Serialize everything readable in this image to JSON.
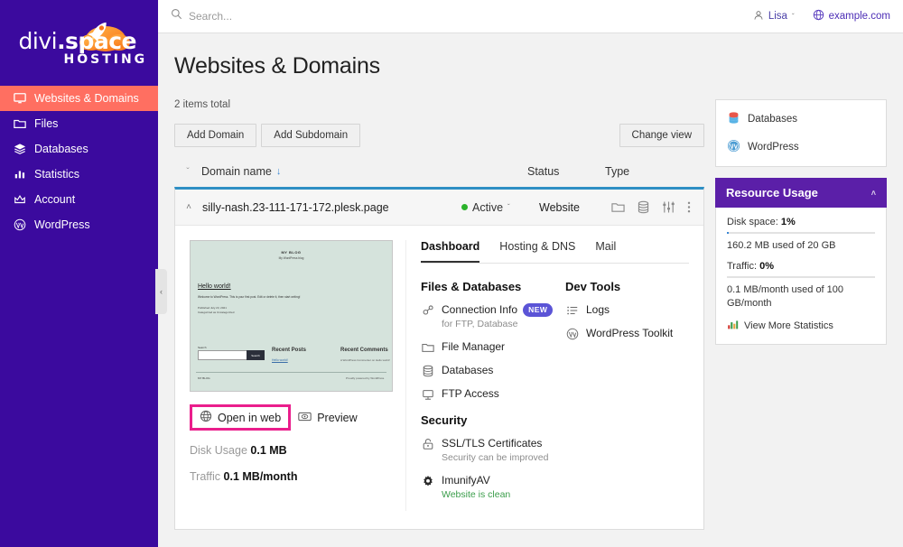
{
  "brand": {
    "logo_text_1": "divi",
    "logo_text_2": ".space",
    "logo_sub": "HOSTING",
    "sidebar_bg": "#3b0a9e",
    "active_bg": "#ff6f61",
    "accent_purple": "#5b1fa8",
    "highlight_pink": "#ea1e8c"
  },
  "sidebar": {
    "items": [
      {
        "label": "Websites & Domains",
        "icon": "monitor-icon",
        "active": true
      },
      {
        "label": "Files",
        "icon": "folder-icon",
        "active": false
      },
      {
        "label": "Databases",
        "icon": "layers-icon",
        "active": false
      },
      {
        "label": "Statistics",
        "icon": "bar-chart-icon",
        "active": false
      },
      {
        "label": "Account",
        "icon": "crown-icon",
        "active": false
      },
      {
        "label": "WordPress",
        "icon": "wordpress-icon",
        "active": false
      }
    ],
    "collapse_glyph": "‹"
  },
  "topbar": {
    "search_placeholder": "Search...",
    "search_value": "",
    "user_label": "Lisa",
    "domain_label": "example.com",
    "caret": "ˇ"
  },
  "header": {
    "title": "Websites & Domains"
  },
  "toolbar": {
    "items_total": "2 items total",
    "add_domain": "Add Domain",
    "add_subdomain": "Add Subdomain",
    "change_view": "Change view"
  },
  "table": {
    "columns": {
      "domain": "Domain name",
      "status": "Status",
      "type": "Type"
    },
    "sort_arrow": "↓",
    "expand_all_glyph": "ˇ",
    "row": {
      "collapse_glyph": "˄",
      "domain": "silly-nash.23-111-171-172.plesk.page",
      "status": "Active",
      "status_color": "#2bb32b",
      "type": "Website",
      "actions": [
        "folder-icon",
        "database-icon",
        "sliders-icon",
        "kebab-menu-icon"
      ]
    }
  },
  "thumbnail": {
    "site_title": "MY BLOG",
    "site_tagline": "My WordPress blog",
    "post_title": "Hello world!",
    "post_excerpt": "Welcome to WordPress. This is your first post. Edit or delete it, then start writing!",
    "post_meta_1": "Published July 23, 2021",
    "post_meta_2": "Categorized as Uncategorized",
    "search_label": "Search",
    "search_button": "Search",
    "recent_posts_title": "Recent Posts",
    "recent_posts_link": "Hello world!",
    "recent_comments_title": "Recent Comments",
    "recent_comments_text": "A WordPress Commenter on Hello world!",
    "footer_left": "MY BLOG",
    "footer_right": "Proudly powered by WordPress."
  },
  "thumb_actions": {
    "open_in_web": "Open in web",
    "open_in_web_icon": "globe-icon",
    "preview": "Preview",
    "preview_icon": "preview-icon"
  },
  "stats": {
    "disk_label": "Disk Usage",
    "disk_value": "0.1 MB",
    "traffic_label": "Traffic",
    "traffic_value": "0.1 MB/month"
  },
  "tabs": [
    {
      "label": "Dashboard",
      "active": true
    },
    {
      "label": "Hosting & DNS",
      "active": false
    },
    {
      "label": "Mail",
      "active": false
    }
  ],
  "sections": {
    "files_databases": {
      "title": "Files & Databases",
      "links": [
        {
          "label": "Connection Info",
          "icon": "connection-icon",
          "badge": "NEW",
          "sub": "for FTP, Database"
        },
        {
          "label": "File Manager",
          "icon": "folder-icon",
          "badge": "",
          "sub": ""
        },
        {
          "label": "Databases",
          "icon": "database-icon",
          "badge": "",
          "sub": ""
        },
        {
          "label": "FTP Access",
          "icon": "ftp-icon",
          "badge": "",
          "sub": ""
        }
      ]
    },
    "security": {
      "title": "Security",
      "links": [
        {
          "label": "SSL/TLS Certificates",
          "icon": "lock-icon",
          "badge": "",
          "sub": "Security can be improved",
          "sub_green": false
        },
        {
          "label": "ImunifyAV",
          "icon": "gear-icon",
          "badge": "",
          "sub": "Website is clean",
          "sub_green": true
        }
      ]
    },
    "dev_tools": {
      "title": "Dev Tools",
      "links": [
        {
          "label": "Logs",
          "icon": "list-icon",
          "badge": "",
          "sub": ""
        },
        {
          "label": "WordPress Toolkit",
          "icon": "wordpress-icon",
          "badge": "",
          "sub": ""
        }
      ]
    }
  },
  "right_panel": {
    "shortcuts": [
      {
        "label": "Databases",
        "icon": "database-icon"
      },
      {
        "label": "WordPress",
        "icon": "wordpress-icon"
      }
    ],
    "resource_usage": {
      "title": "Resource Usage",
      "collapse_glyph": "˄",
      "disk_label": "Disk space:",
      "disk_percent": "1%",
      "disk_percent_num": 1,
      "disk_value": "160.2 MB used of 20 GB",
      "traffic_label": "Traffic:",
      "traffic_percent": "0%",
      "traffic_percent_num": 0,
      "traffic_value": "0.1 MB/month used of 100 GB/month",
      "more_stats": "View More Statistics",
      "more_stats_icon": "bar-chart-icon"
    }
  }
}
